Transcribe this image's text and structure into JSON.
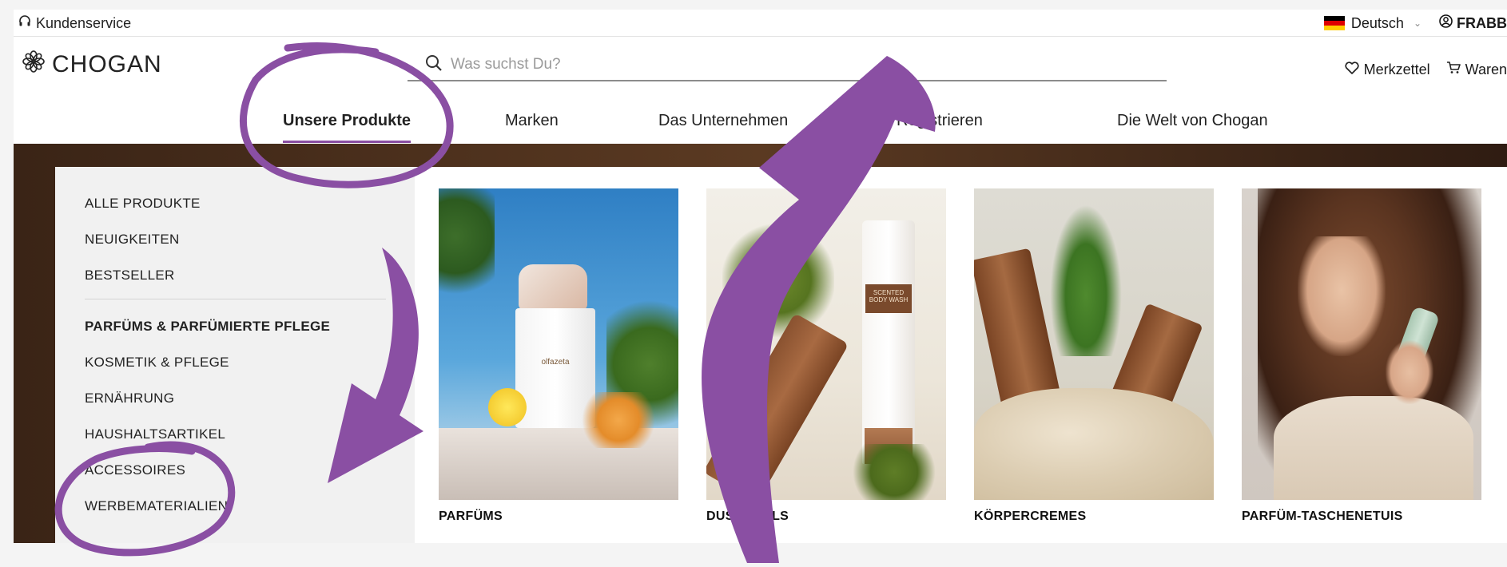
{
  "utility": {
    "customer_service": "Kundenservice",
    "language": "Deutsch",
    "user": "FRABB"
  },
  "header": {
    "logo_text": "CHOGAN",
    "search_placeholder": "Was suchst Du?",
    "wishlist": "Merkzettel",
    "cart": "Waren"
  },
  "nav": {
    "items": [
      "Unsere Produkte",
      "Marken",
      "Das Unternehmen",
      "Registrieren",
      "Die Welt von Chogan"
    ]
  },
  "sidemenu": {
    "items": [
      {
        "label": "ALLE PRODUKTE",
        "bold": false
      },
      {
        "label": "NEUIGKEITEN",
        "bold": false
      },
      {
        "label": "BESTSELLER",
        "bold": false
      },
      {
        "label": "PARFÜMS & PARFÜMIERTE PFLEGE",
        "bold": true
      },
      {
        "label": "KOSMETIK & PFLEGE",
        "bold": false
      },
      {
        "label": "ERNÄHRUNG",
        "bold": false
      },
      {
        "label": "HAUSHALTSARTIKEL",
        "bold": false
      },
      {
        "label": "ACCESSOIRES",
        "bold": false
      },
      {
        "label": "WERBEMATERIALIEN",
        "bold": false
      }
    ]
  },
  "products": [
    {
      "label": "PARFÜMS"
    },
    {
      "label": "DUSCHGELS"
    },
    {
      "label": "KÖRPERCREMES"
    },
    {
      "label": "PARFÜM-TASCHENETUIS"
    }
  ],
  "packaging": {
    "brand": "olfazeta",
    "tube_text": "SCENTED BODY WASH"
  },
  "colors": {
    "accent": "#8a4fa3",
    "annotation": "#8a4fa3",
    "banner": "#4a2e1b"
  },
  "icons": {
    "customer_service": "headset-icon",
    "search": "search-icon",
    "wishlist": "heart-icon",
    "cart": "cart-icon",
    "user": "user-circle-icon",
    "logo": "flower-logo-icon"
  }
}
